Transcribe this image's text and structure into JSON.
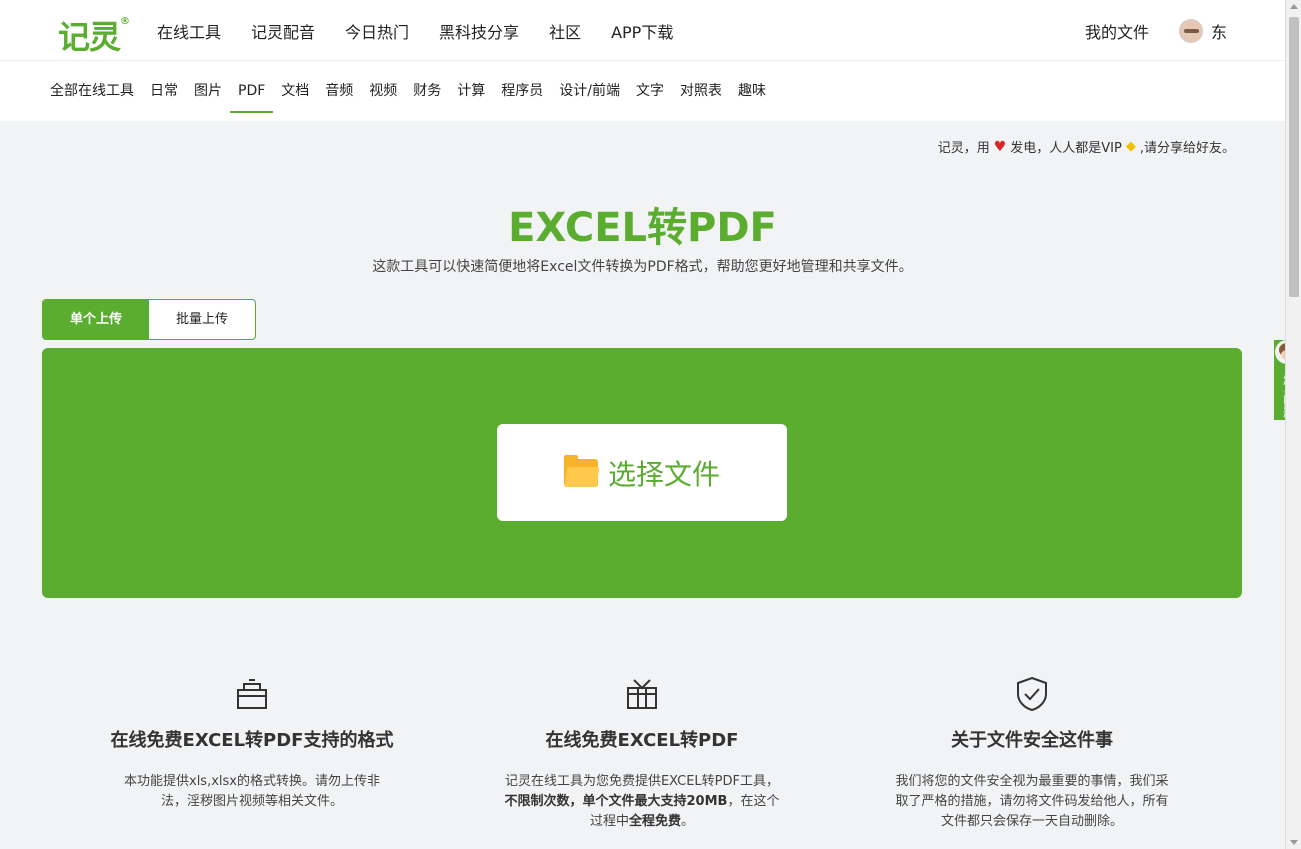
{
  "header": {
    "logo": "记灵",
    "logo_mark": "®",
    "nav": [
      "在线工具",
      "记灵配音",
      "今日热门",
      "黑科技分享",
      "社区",
      "APP下载"
    ],
    "my_files": "我的文件",
    "username": "东"
  },
  "categories": {
    "items": [
      "全部在线工具",
      "日常",
      "图片",
      "PDF",
      "文档",
      "音频",
      "视频",
      "财务",
      "计算",
      "程序员",
      "设计/前端",
      "文字",
      "对照表",
      "趣味"
    ],
    "active": "PDF"
  },
  "notice": {
    "part1": "记灵，用",
    "part2": "发电，人人都是VIP",
    "part3": ",请分享给好友。",
    "heart": "♥",
    "diamond": "◆"
  },
  "main": {
    "title": "EXCEL转PDF",
    "subtitle": "这款工具可以快速简便地将Excel文件转换为PDF格式，帮助您更好地管理和共享文件。"
  },
  "upload_tabs": {
    "single": "单个上传",
    "batch": "批量上传"
  },
  "upload": {
    "choose_label": "选择文件"
  },
  "features": [
    {
      "icon": "box-icon",
      "title": "在线免费EXCEL转PDF支持的格式",
      "text": "本功能提供xls,xlsx的格式转换。请勿上传非法，淫秽图片视频等相关文件。"
    },
    {
      "icon": "gift-icon",
      "title": "在线免费EXCEL转PDF",
      "text_a": "记灵在线工具为您免费提供EXCEL转PDF工具，",
      "text_b": "不限制次数，单个文件最大支持20MB",
      "text_c": "，在这个过程中",
      "text_d": "全程免费",
      "text_e": "。"
    },
    {
      "icon": "shield-check-icon",
      "title": "关于文件安全这件事",
      "text": "我们将您的文件安全视为最重要的事情，我们采取了严格的措施，请勿将文件码发给他人，所有文件都只会保存一天自动删除。"
    }
  ],
  "feedback": {
    "label": "反馈问题"
  },
  "colors": {
    "brand": "#5aad2f",
    "background": "#f2f3f5"
  }
}
